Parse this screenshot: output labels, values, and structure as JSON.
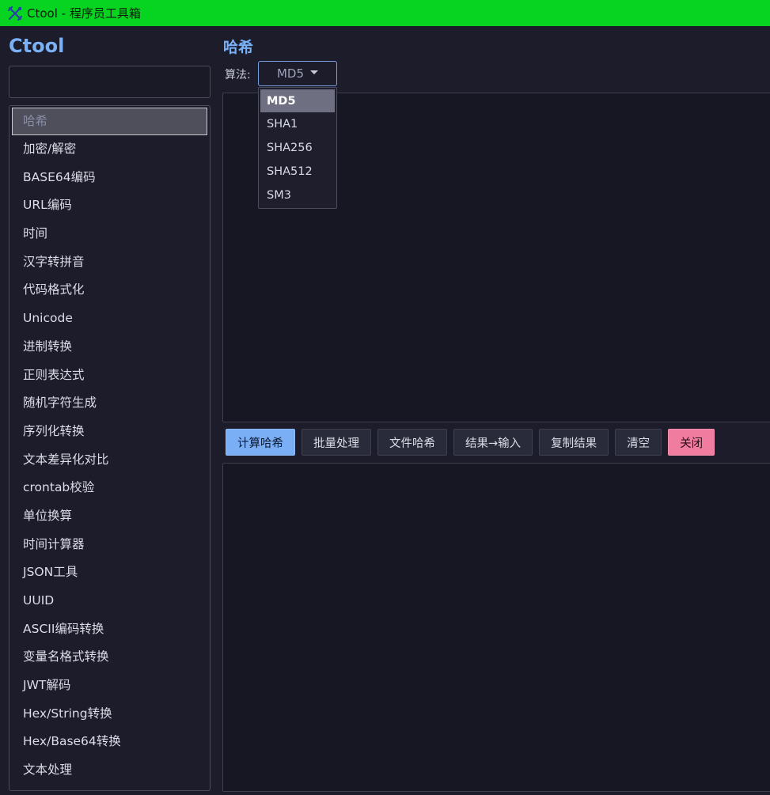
{
  "window": {
    "title": "Ctool - 程序员工具箱",
    "titlebar_color": "#07d420"
  },
  "sidebar": {
    "brand": "Ctool",
    "search": {
      "value": "",
      "placeholder": ""
    },
    "items": [
      {
        "label": "哈希",
        "active": true
      },
      {
        "label": "加密/解密"
      },
      {
        "label": "BASE64编码"
      },
      {
        "label": "URL编码"
      },
      {
        "label": "时间"
      },
      {
        "label": "汉字转拼音"
      },
      {
        "label": "代码格式化"
      },
      {
        "label": "Unicode"
      },
      {
        "label": "进制转换"
      },
      {
        "label": "正则表达式"
      },
      {
        "label": "随机字符生成"
      },
      {
        "label": "序列化转换"
      },
      {
        "label": "文本差异化对比"
      },
      {
        "label": "crontab校验"
      },
      {
        "label": "单位换算"
      },
      {
        "label": "时间计算器"
      },
      {
        "label": "JSON工具"
      },
      {
        "label": "UUID"
      },
      {
        "label": "ASCII编码转换"
      },
      {
        "label": "变量名格式转换"
      },
      {
        "label": "JWT解码"
      },
      {
        "label": "Hex/String转换"
      },
      {
        "label": "Hex/Base64转换"
      },
      {
        "label": "文本处理"
      }
    ]
  },
  "main": {
    "title": "哈希",
    "algorithm": {
      "label": "算法:",
      "selected": "MD5",
      "options": [
        "MD5",
        "SHA1",
        "SHA256",
        "SHA512",
        "SM3"
      ]
    },
    "input": {
      "value": ""
    },
    "toolbar": {
      "compute": "计算哈希",
      "batch": "批量处理",
      "file_hash": "文件哈希",
      "result_to_input": "结果→输入",
      "copy_result": "复制结果",
      "clear": "清空",
      "close": "关闭"
    },
    "output": {
      "value": ""
    }
  },
  "colors": {
    "accent": "#7ab0f5",
    "primary_button": "#7aaef5",
    "danger_button": "#f07ca0"
  }
}
